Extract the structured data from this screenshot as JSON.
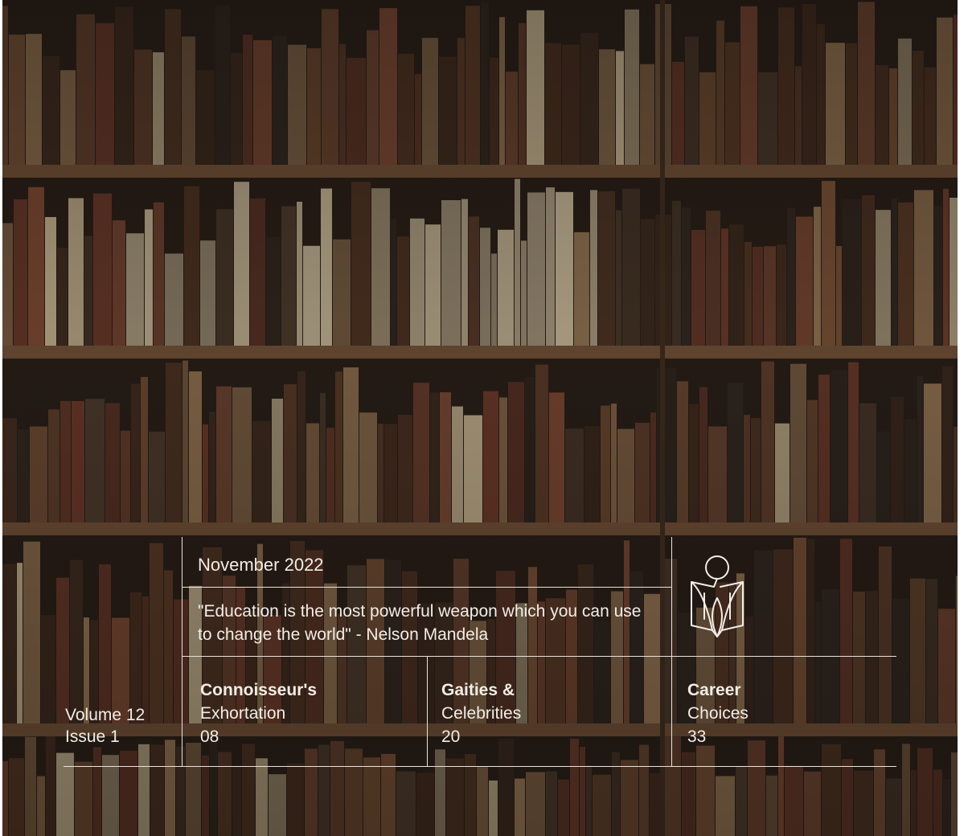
{
  "header": {
    "date": "November 2022",
    "quote": "\"Education is the most powerful weapon which you can use to change the world\" - Nelson Mandela"
  },
  "issue": {
    "volume": "Volume 12",
    "issue": "Issue 1"
  },
  "sections": [
    {
      "title": "Connoisseur's",
      "subtitle": "Exhortation",
      "page": "08"
    },
    {
      "title": "Gaities &",
      "subtitle": "Celebrities",
      "page": "20"
    },
    {
      "title": "Career",
      "subtitle": "Choices",
      "page": "33"
    }
  ],
  "logo": {
    "icon": "reader-book-icon"
  },
  "colors": {
    "lines": "#e8e3dc",
    "text": "#f2ede6",
    "background": "#241b15"
  }
}
